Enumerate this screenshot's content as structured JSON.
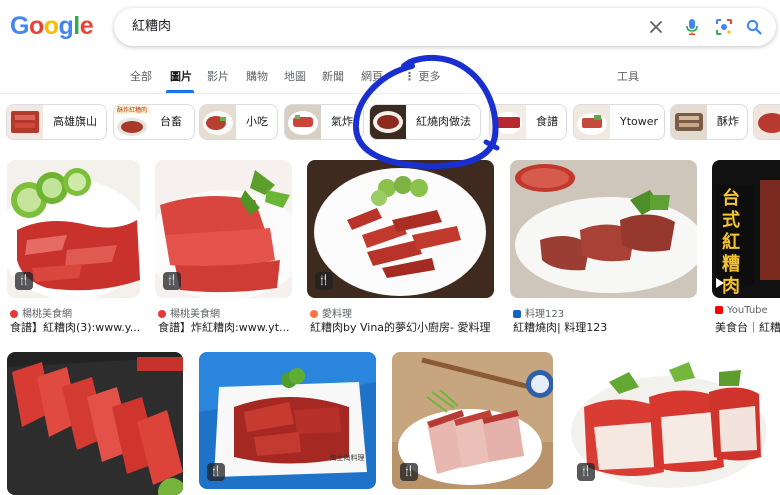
{
  "header": {
    "logo_letters": [
      "G",
      "o",
      "o",
      "g",
      "l",
      "e"
    ],
    "logo_colors": [
      "#4285f4",
      "#ea4335",
      "#fbbc05",
      "#4285f4",
      "#34a853",
      "#ea4335"
    ],
    "search_query": "紅糟肉"
  },
  "tabs": [
    {
      "label": "全部",
      "active": false
    },
    {
      "label": "圖片",
      "active": true
    },
    {
      "label": "影片",
      "active": false
    },
    {
      "label": "購物",
      "active": false
    },
    {
      "label": "地圖",
      "active": false
    },
    {
      "label": "新聞",
      "active": false
    },
    {
      "label": "網頁",
      "active": false
    },
    {
      "label": "更多",
      "active": false
    }
  ],
  "tools_label": "工具",
  "chips": [
    {
      "label": "高雄旗山"
    },
    {
      "label": "台畜"
    },
    {
      "label": "小吃"
    },
    {
      "label": "氣炸"
    },
    {
      "label": "紅燒肉做法"
    },
    {
      "label": "食譜"
    },
    {
      "label": "Ytower"
    },
    {
      "label": "酥炸"
    }
  ],
  "results": [
    {
      "source": "楊桃美食網",
      "title": "食譜】紅糟肉(3):www.y...",
      "fav_color": "#e53935"
    },
    {
      "source": "楊桃美食網",
      "title": "食譜】炸紅糟肉:www.yt...",
      "fav_color": "#e53935"
    },
    {
      "source": "愛料理",
      "title": "紅糟肉by Vina的夢幻小廚房- 愛料理",
      "fav_color": "#ff7043"
    },
    {
      "source": "料理123",
      "title": "紅糟燒肉| 料理123",
      "fav_color": "#1565c0"
    },
    {
      "source": "YouTube",
      "title": "美食台｜紅糟",
      "fav_color": "#ff0000"
    }
  ],
  "thumbnail_texts": {
    "chip_thumb_caption": "酥炸紅糟肉",
    "video_thumb_text": "台式紅糟肉",
    "watermark": "陶土陶料理"
  },
  "recipe_badge_icon": "fork-knife-icon",
  "colors": {
    "accent_blue": "#1a73e8",
    "annotation_blue": "#1a2fd0"
  }
}
